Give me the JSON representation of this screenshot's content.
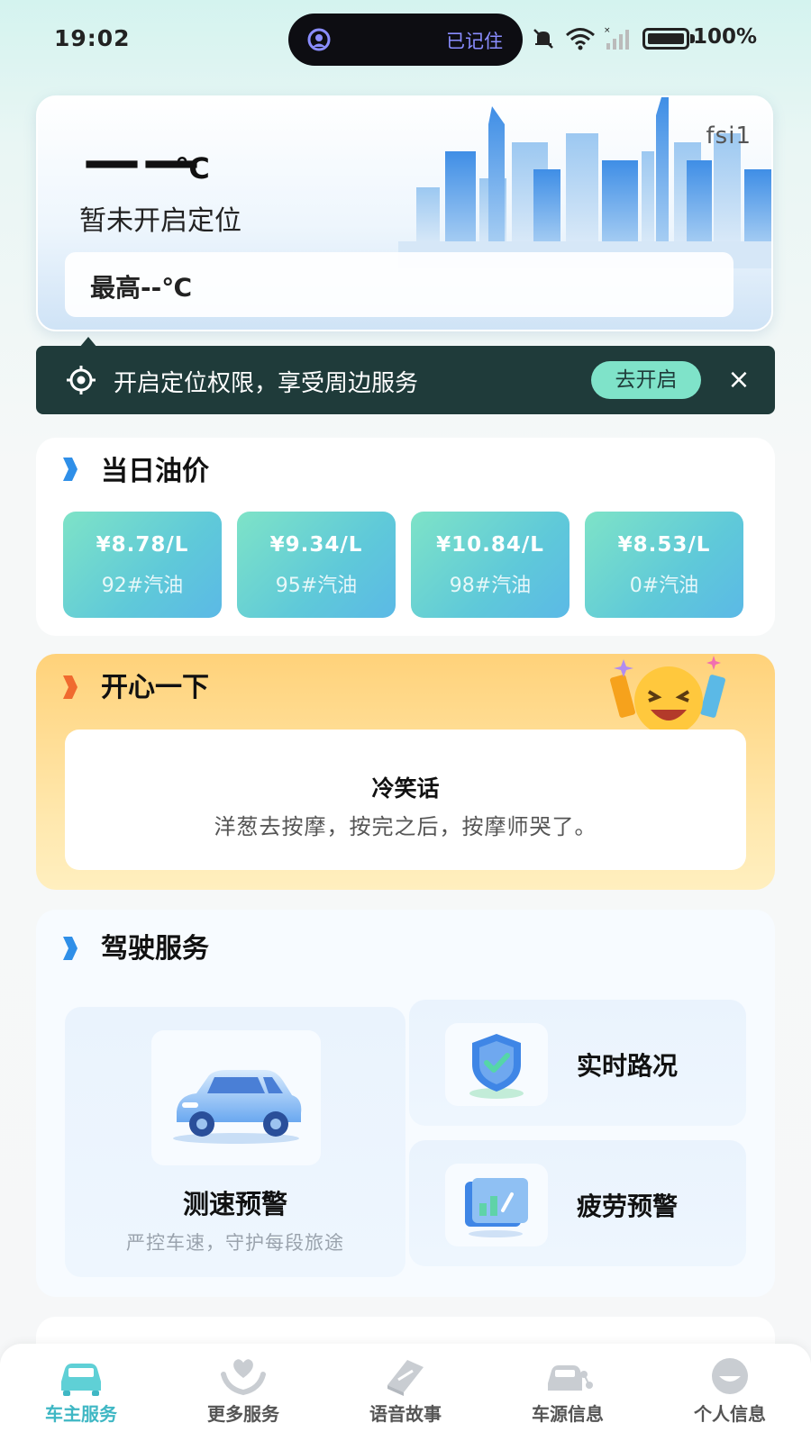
{
  "status_bar": {
    "time": "19:02",
    "island_text": "已记住",
    "battery": "100%"
  },
  "weather": {
    "temperature": "——",
    "unit": "℃",
    "location": "暂未开启定位",
    "city_code": "fsi1",
    "max_temp": "最高--℃"
  },
  "location_banner": {
    "text": "开启定位权限，享受周边服务",
    "button": "去开启",
    "close": "×"
  },
  "oil": {
    "title": "当日油价",
    "items": [
      {
        "price": "¥8.78/L",
        "name": "92#汽油"
      },
      {
        "price": "¥9.34/L",
        "name": "95#汽油"
      },
      {
        "price": "¥10.84/L",
        "name": "98#汽油"
      },
      {
        "price": "¥8.53/L",
        "name": "0#汽油"
      }
    ]
  },
  "joke": {
    "title": "开心一下",
    "card_title": "冷笑话",
    "text": "洋葱去按摩，按完之后，按摩师哭了。"
  },
  "driving": {
    "title": "驾驶服务",
    "speed": {
      "title": "测速预警",
      "subtitle": "严控车速，守护每段旅途"
    },
    "traffic": {
      "title": "实时路况"
    },
    "fatigue": {
      "title": "疲劳预警"
    }
  },
  "nav": [
    {
      "label": "车主服务",
      "icon": "car-icon",
      "active": true
    },
    {
      "label": "更多服务",
      "icon": "heart-hand-icon",
      "active": false
    },
    {
      "label": "语音故事",
      "icon": "book-icon",
      "active": false
    },
    {
      "label": "车源信息",
      "icon": "car-share-icon",
      "active": false
    },
    {
      "label": "个人信息",
      "icon": "user-icon",
      "active": false
    }
  ],
  "colors": {
    "accent": "#3fb7c4",
    "banner_bg": "#1f3b3a",
    "banner_button": "#7fe3c9",
    "oil_gradient_start": "#7ee3c7",
    "oil_gradient_end": "#5bb9e6",
    "joke_bg": "#ffd27a"
  }
}
